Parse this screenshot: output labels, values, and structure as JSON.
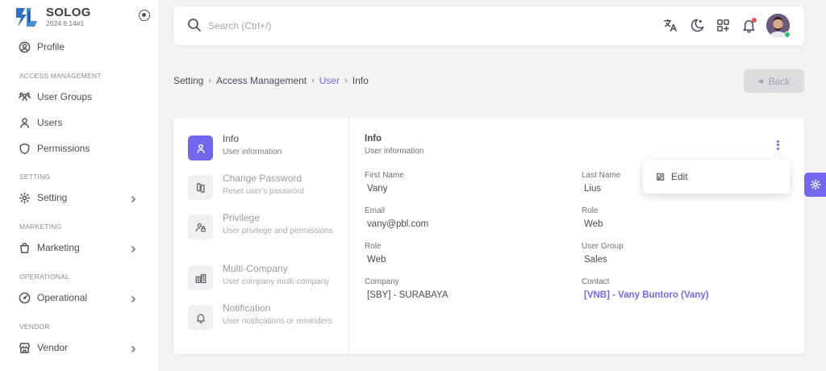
{
  "brand": {
    "name": "SOLOG",
    "version": "2024.6.14#1"
  },
  "sidebar": {
    "profile": {
      "label": "Profile",
      "icon": "user-circle-icon"
    },
    "sections": {
      "access": "ACCESS MANAGEMENT",
      "setting": "SETTING",
      "marketing": "MARKETING",
      "operational": "OPERATIONAL",
      "vendor": "VENDOR"
    },
    "items": {
      "user_groups": "User Groups",
      "users": "Users",
      "permissions": "Permissions",
      "setting": "Setting",
      "marketing": "Marketing",
      "operational": "Operational",
      "vendor": "Vendor"
    }
  },
  "search": {
    "placeholder": "Search (Ctrl+/)"
  },
  "topbar": {
    "icons": [
      "translate-icon",
      "theme-toggle-icon",
      "shortcuts-icon",
      "notification-bell-icon"
    ],
    "avatar": "user-avatar"
  },
  "breadcrumb": {
    "items": [
      "Setting",
      "Access Management",
      "User",
      "Info"
    ],
    "active_index": 2,
    "separator": "›"
  },
  "back_button": {
    "label": "Back"
  },
  "tabs": [
    {
      "title": "Info",
      "sub": "User information",
      "icon": "user-icon",
      "active": true
    },
    {
      "title": "Change Password",
      "sub": "Reset user's password",
      "icon": "key-icon",
      "active": false
    },
    {
      "title": "Privilege",
      "sub": "User privilege and permissions",
      "icon": "user-lock-icon",
      "active": false
    },
    {
      "title": "Multi-Company",
      "sub": "User company multi-company",
      "icon": "company-icon",
      "active": false
    },
    {
      "title": "Notification",
      "sub": "User notifications or reminders",
      "icon": "bell-icon",
      "active": false
    }
  ],
  "info": {
    "title": "Info",
    "subtitle": "User information",
    "fields": {
      "first_name": {
        "label": "First Name",
        "value": "Vany"
      },
      "last_name": {
        "label": "Last Name",
        "value": "Lius"
      },
      "email": {
        "label": "Email",
        "value": "vany@pbl.com"
      },
      "role_right": {
        "label": "Role",
        "value": "Web"
      },
      "role_left": {
        "label": "Role",
        "value": "Web"
      },
      "user_group": {
        "label": "User Group",
        "value": "Sales"
      },
      "company": {
        "label": "Company",
        "value": "[SBY] - SURABAYA"
      },
      "contact": {
        "label": "Contact",
        "value": "[VNB] - Vany Buntoro (Vany)"
      }
    }
  },
  "dropdown": {
    "edit_label": "Edit"
  },
  "colors": {
    "primary": "#7367f0",
    "danger": "#ea5455",
    "success": "#28c76f"
  }
}
